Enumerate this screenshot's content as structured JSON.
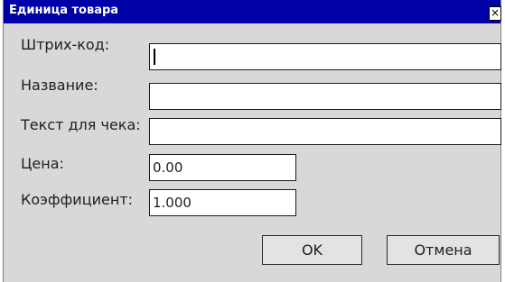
{
  "window": {
    "title": "Единица товара",
    "close_label": "×"
  },
  "form": {
    "barcode_label": "Штрих-код:",
    "barcode_value": "",
    "name_label": "Название:",
    "name_value": "",
    "receipt_text_label": "Текст для чека:",
    "receipt_text_value": "",
    "price_label": "Цена:",
    "price_value": "0.00",
    "coefficient_label": "Коэффициент:",
    "coefficient_value": "1.000"
  },
  "buttons": {
    "ok_label": "OK",
    "cancel_label": "Отмена"
  }
}
